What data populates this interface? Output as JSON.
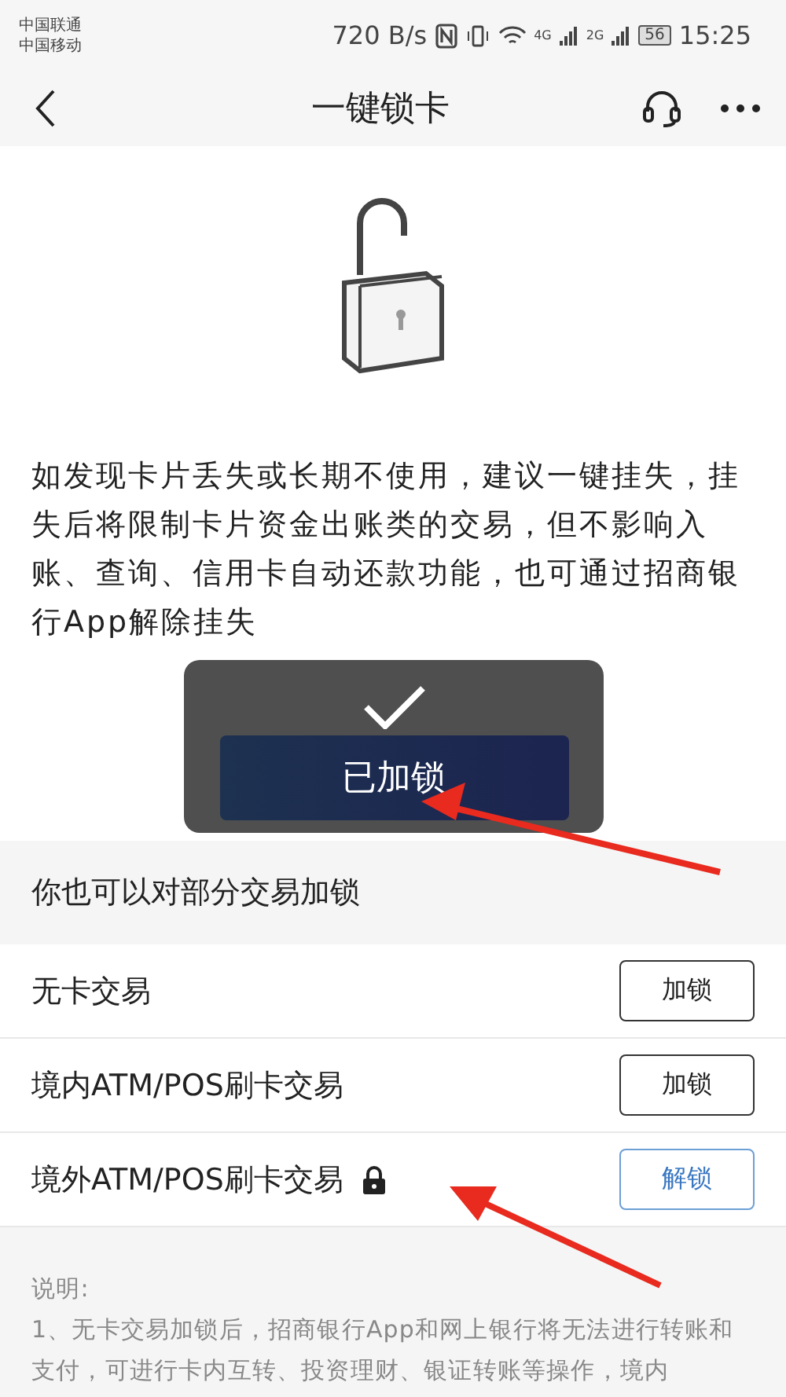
{
  "status_bar": {
    "carriers": [
      "中国联通",
      "中国移动"
    ],
    "speed": "720 B/s",
    "network_1": "4G",
    "network_2": "2G",
    "battery": "56",
    "time": "15:25"
  },
  "nav": {
    "title": "一键锁卡"
  },
  "intro": "如发现卡片丢失或长期不使用，建议一键挂失，挂失后将限制卡片资金出账类的交易，但不影响入账、查询、信用卡自动还款功能，也可通过招商银行App解除挂失",
  "toast": {
    "text": "已加锁"
  },
  "section_title": "你也可以对部分交易加锁",
  "rows": [
    {
      "label": "无卡交易",
      "button": "加锁",
      "locked": false
    },
    {
      "label": "境内ATM/POS刷卡交易",
      "button": "加锁",
      "locked": false
    },
    {
      "label": "境外ATM/POS刷卡交易",
      "button": "解锁",
      "locked": true
    }
  ],
  "notes": {
    "title": "说明:",
    "text": "1、无卡交易加锁后，招商银行App和网上银行将无法进行转账和支付，可进行卡内互转、投资理财、银证转账等操作，境内"
  }
}
